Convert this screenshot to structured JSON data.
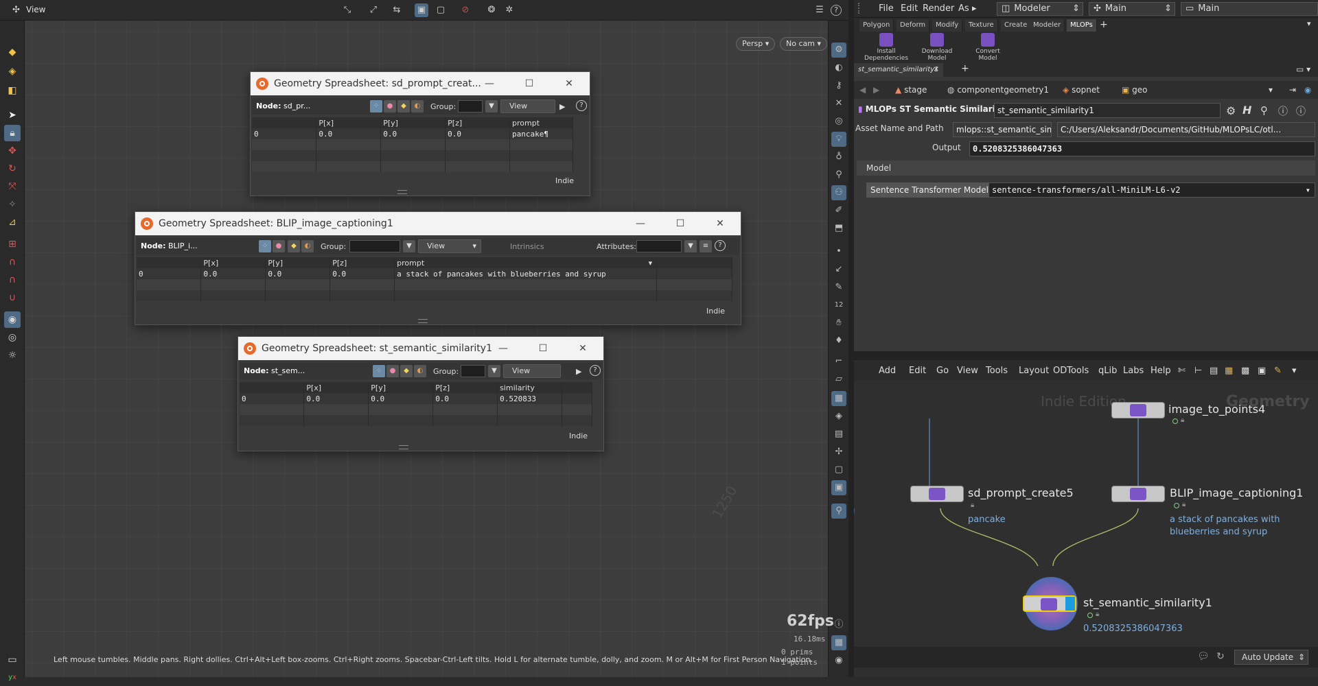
{
  "viewport": {
    "title": "View",
    "camera_label": "Persp",
    "cam_select_label": "No cam",
    "fps": "62fps",
    "frame_time": "16.18ms",
    "prims": "0  prims",
    "points": "1  points",
    "hint": "Left mouse tumbles. Middle pans. Right dollies. Ctrl+Alt+Left box-zooms. Ctrl+Right zooms. Spacebar-Ctrl-Left tilts. Hold L for alternate tumble, dolly, and zoom.     M or Alt+M for First Person Navigation.",
    "grid_label": "1250"
  },
  "spreadsheets": [
    {
      "title": "Geometry Spreadsheet:  sd_prompt_creat...",
      "node_label": "Node:",
      "node_value": "sd_pr...",
      "group_label": "Group:",
      "view_label": "View",
      "columns": [
        "",
        "P[x]",
        "P[y]",
        "P[z]",
        "prompt"
      ],
      "row": [
        "0",
        "0.0",
        "0.0",
        "0.0",
        "pancake¶"
      ],
      "footer": "Indie"
    },
    {
      "title": "Geometry Spreadsheet:  BLIP_image_captioning1",
      "node_label": "Node:",
      "node_value": "BLIP_i...",
      "group_label": "Group:",
      "view_label": "View",
      "intrinsics_label": "Intrinsics",
      "attributes_label": "Attributes:",
      "columns": [
        "",
        "P[x]",
        "P[y]",
        "P[z]",
        "prompt"
      ],
      "row": [
        "0",
        "0.0",
        "0.0",
        "0.0",
        "a stack of pancakes with blueberries and syrup"
      ],
      "footer": "Indie"
    },
    {
      "title": "Geometry Spreadsheet:  st_semantic_similarity1",
      "node_label": "Node:",
      "node_value": "st_sem...",
      "group_label": "Group:",
      "view_label": "View",
      "columns": [
        "",
        "P[x]",
        "P[y]",
        "P[z]",
        "similarity"
      ],
      "row": [
        "0",
        "0.0",
        "0.0",
        "0.0",
        "0.520833"
      ],
      "footer": "Indie"
    }
  ],
  "menubar": {
    "items": [
      "File",
      "Edit",
      "Render",
      "As"
    ],
    "desktop": "Modeler",
    "main1": "Main",
    "main2": "Main"
  },
  "shelf": {
    "tabs": [
      "Polygon",
      "Deform",
      "Modify",
      "Texture",
      "Create",
      "Modeler",
      "MLOPs"
    ],
    "active_tab": "MLOPs",
    "tools": [
      {
        "l1": "Install",
        "l2": "Dependencies"
      },
      {
        "l1": "Download",
        "l2": "Model"
      },
      {
        "l1": "Convert",
        "l2": "Model"
      }
    ]
  },
  "params": {
    "pane_tab": "st_semantic_similarity1",
    "path": [
      "stage",
      "componentgeometry1",
      "sopnet",
      "geo"
    ],
    "node_type": "MLOPs ST Semantic Similarity",
    "node_name": "st_semantic_similarity1",
    "asset_label": "Asset Name and Path",
    "asset_name": "mlops::st_semantic_sim...",
    "asset_path": "C:/Users/Aleksandr/Documents/GitHub/MLOPsLC/otl...",
    "output_label": "Output",
    "output_value": "0.5208325386047363",
    "folder_label": "Model",
    "model_label": "Sentence Transformer Model",
    "model_value": "sentence-transformers/all-MiniLM-L6-v2"
  },
  "network": {
    "menu": [
      "Add",
      "Edit",
      "Go",
      "View",
      "Tools",
      "Layout",
      "ODTools",
      "qLib",
      "Labs",
      "Help"
    ],
    "watermark": "Indie Edition",
    "context": "Geometry",
    "update_mode": "Auto Update",
    "nodes": {
      "n1": {
        "name": "image_to_points4",
        "comment": ""
      },
      "n2": {
        "name": "sd_prompt_create5",
        "comment": "pancake"
      },
      "n3": {
        "name": "BLIP_image_captioning1",
        "comment_l1": "a stack of pancakes with",
        "comment_l2": "blueberries and syrup"
      },
      "n4": {
        "name": "st_semantic_similarity1",
        "comment": "0.5208325386047363"
      }
    }
  },
  "colors": {
    "accent": "#4f6a85",
    "node_selected": "#f0d000",
    "comment": "#7fb0e0",
    "houdini_logo": "#e8692c"
  }
}
